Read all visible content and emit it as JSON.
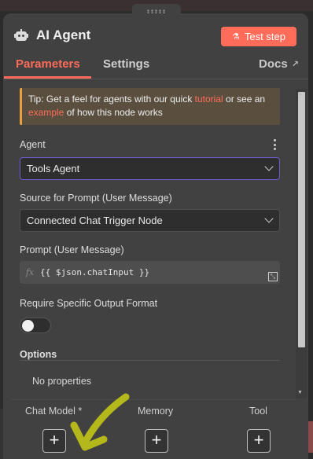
{
  "node": {
    "title": "AI Agent",
    "test_button": "Test step"
  },
  "tabs": {
    "parameters": "Parameters",
    "settings": "Settings",
    "docs": "Docs"
  },
  "tip": {
    "prefix": "Tip: Get a feel for agents with our quick ",
    "link1": "tutorial",
    "middle": " or see an ",
    "link2": "example",
    "suffix": " of how this node works"
  },
  "fields": {
    "agent_label": "Agent",
    "agent_value": "Tools Agent",
    "source_label": "Source for Prompt (User Message)",
    "source_value": "Connected Chat Trigger Node",
    "prompt_label": "Prompt (User Message)",
    "prompt_value": "{{ $json.chatInput }}",
    "prompt_fx": "fx",
    "output_format_label": "Require Specific Output Format"
  },
  "options": {
    "label": "Options",
    "empty": "No properties"
  },
  "slots": {
    "chat_model": "Chat Model *",
    "memory": "Memory",
    "tool": "Tool"
  },
  "colors": {
    "accent": "#ff6d5a",
    "panel": "#414141",
    "annotation": "#b5b81a"
  }
}
